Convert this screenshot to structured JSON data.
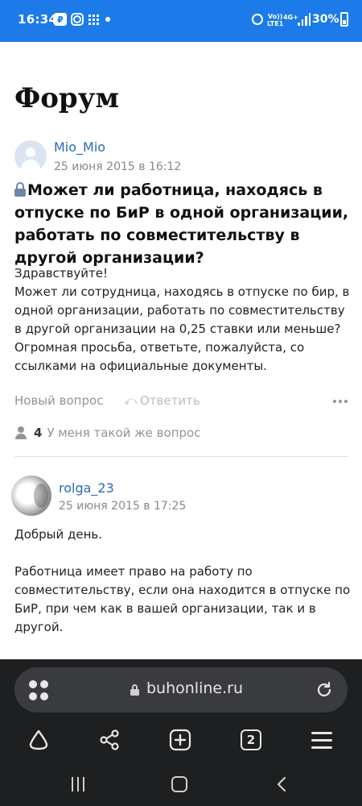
{
  "status_bar": {
    "time": "16:34",
    "network_line1": "Vo))",
    "network_line2": "LTE1",
    "network_type": "4G+",
    "battery": "30%"
  },
  "page": {
    "title": "Форум",
    "post": {
      "author": "Mio_Mio",
      "date": "25 июня 2015 в 16:12",
      "question": "Может ли работница, находясь в отпуске по БиР в одной организации, работать по совместительству в другой организации?",
      "body": [
        "Здравствуйте!",
        "Может ли сотрудница, находясь в отпуске по бир, в одной организации, работать по совместительству в другой организации на 0,25 ставки или меньше? Огромная просьба, ответьте, пожалуйста, со ссылками на официальные документы."
      ],
      "new_question_label": "Новый вопрос",
      "reply_label": "Ответить",
      "same_question_count": "4",
      "same_question_label": "У меня такой же вопрос"
    },
    "answer": {
      "author": "rolga_23",
      "date": "25 июня 2015 в 17:25",
      "paragraphs": [
        "Добрый день.",
        "Работница имеет право на работу по совместительству, если она находится  в отпуске по БиР, при чем как в вашей организации, так и в другой."
      ]
    }
  },
  "browser": {
    "url": "buhonline.ru",
    "tab_count": "2"
  },
  "colors": {
    "status_bar": "#1c7be8",
    "link": "#2a6bb7",
    "browser_bg": "#1d1f21"
  }
}
